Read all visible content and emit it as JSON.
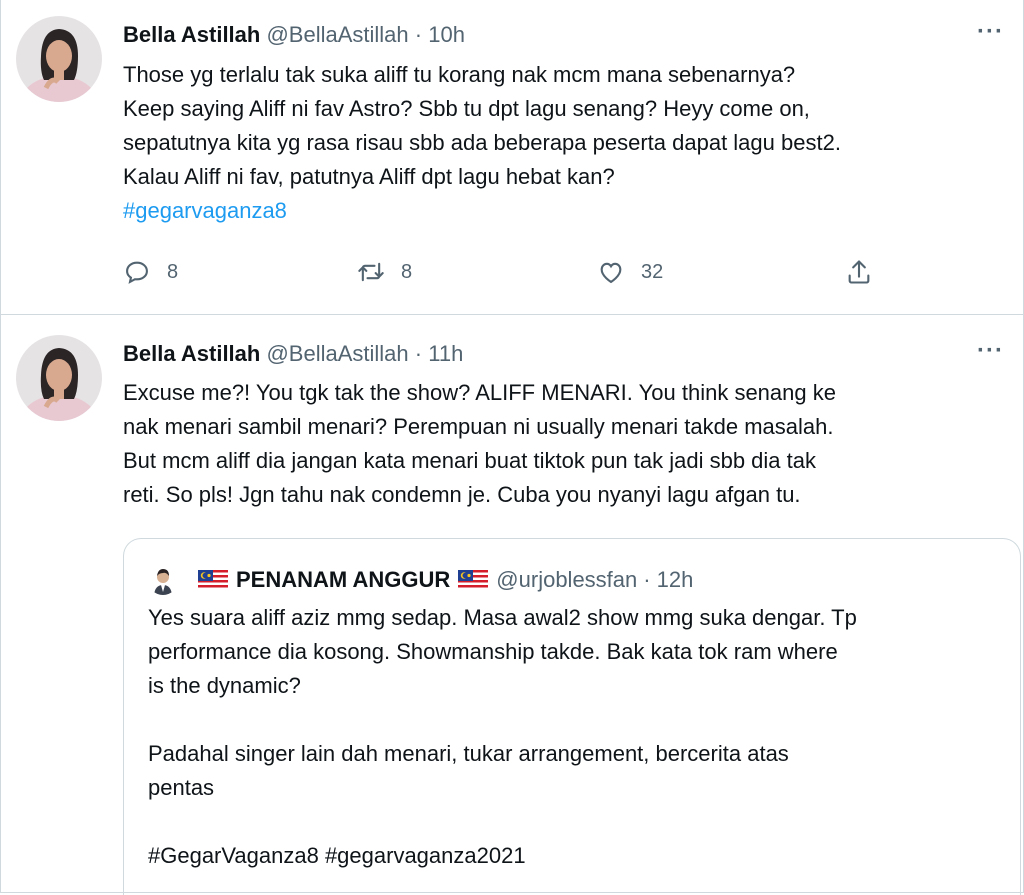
{
  "tweets": [
    {
      "author_name": "Bella Astillah",
      "handle": "@BellaAstillah",
      "time": "10h",
      "more_label": "···",
      "lines": [
        "Those yg terlalu tak suka aliff tu korang nak mcm mana sebenarnya?",
        "Keep saying Aliff ni fav Astro? Sbb tu dpt lagu senang? Heyy come on,",
        "sepatutnya kita yg rasa risau sbb ada beberapa peserta dapat lagu best2.",
        "Kalau Aliff ni fav, patutnya Aliff dpt lagu hebat kan?"
      ],
      "hashtag": "#gegarvaganza8",
      "actions": {
        "reply_count": "8",
        "retweet_count": "8",
        "like_count": "32"
      }
    },
    {
      "author_name": "Bella Astillah",
      "handle": "@BellaAstillah",
      "time": "11h",
      "more_label": "···",
      "lines": [
        "Excuse me?! You tgk tak the show? ALIFF MENARI. You think senang ke",
        "nak menari sambil menari? Perempuan ni usually menari takde masalah.",
        "But mcm aliff dia jangan kata menari buat tiktok pun tak jadi sbb dia tak",
        "reti. So pls! Jgn tahu nak condemn je. Cuba you nyanyi lagu afgan tu."
      ],
      "quoted": {
        "author_name": "PENANAM ANGGUR",
        "handle": "@urjoblessfan",
        "time": "12h",
        "lines": [
          "Yes suara aliff aziz mmg sedap. Masa awal2 show mmg suka dengar. Tp",
          "performance dia kosong. Showmanship takde. Bak kata tok ram where",
          "is the dynamic?"
        ],
        "lines2": [
          "Padahal singer lain dah menari, tukar arrangement, bercerita atas",
          "pentas"
        ],
        "hashtags": "#GegarVaganza8 #gegarvaganza2021"
      }
    }
  ],
  "icons": {
    "reply": "reply-icon",
    "retweet": "retweet-icon",
    "like": "like-icon",
    "share": "share-icon",
    "flag": "malaysia-flag-icon"
  },
  "colors": {
    "text": "#0f1419",
    "secondary": "#536471",
    "link": "#1d9bf0",
    "border": "#cfd9de"
  }
}
